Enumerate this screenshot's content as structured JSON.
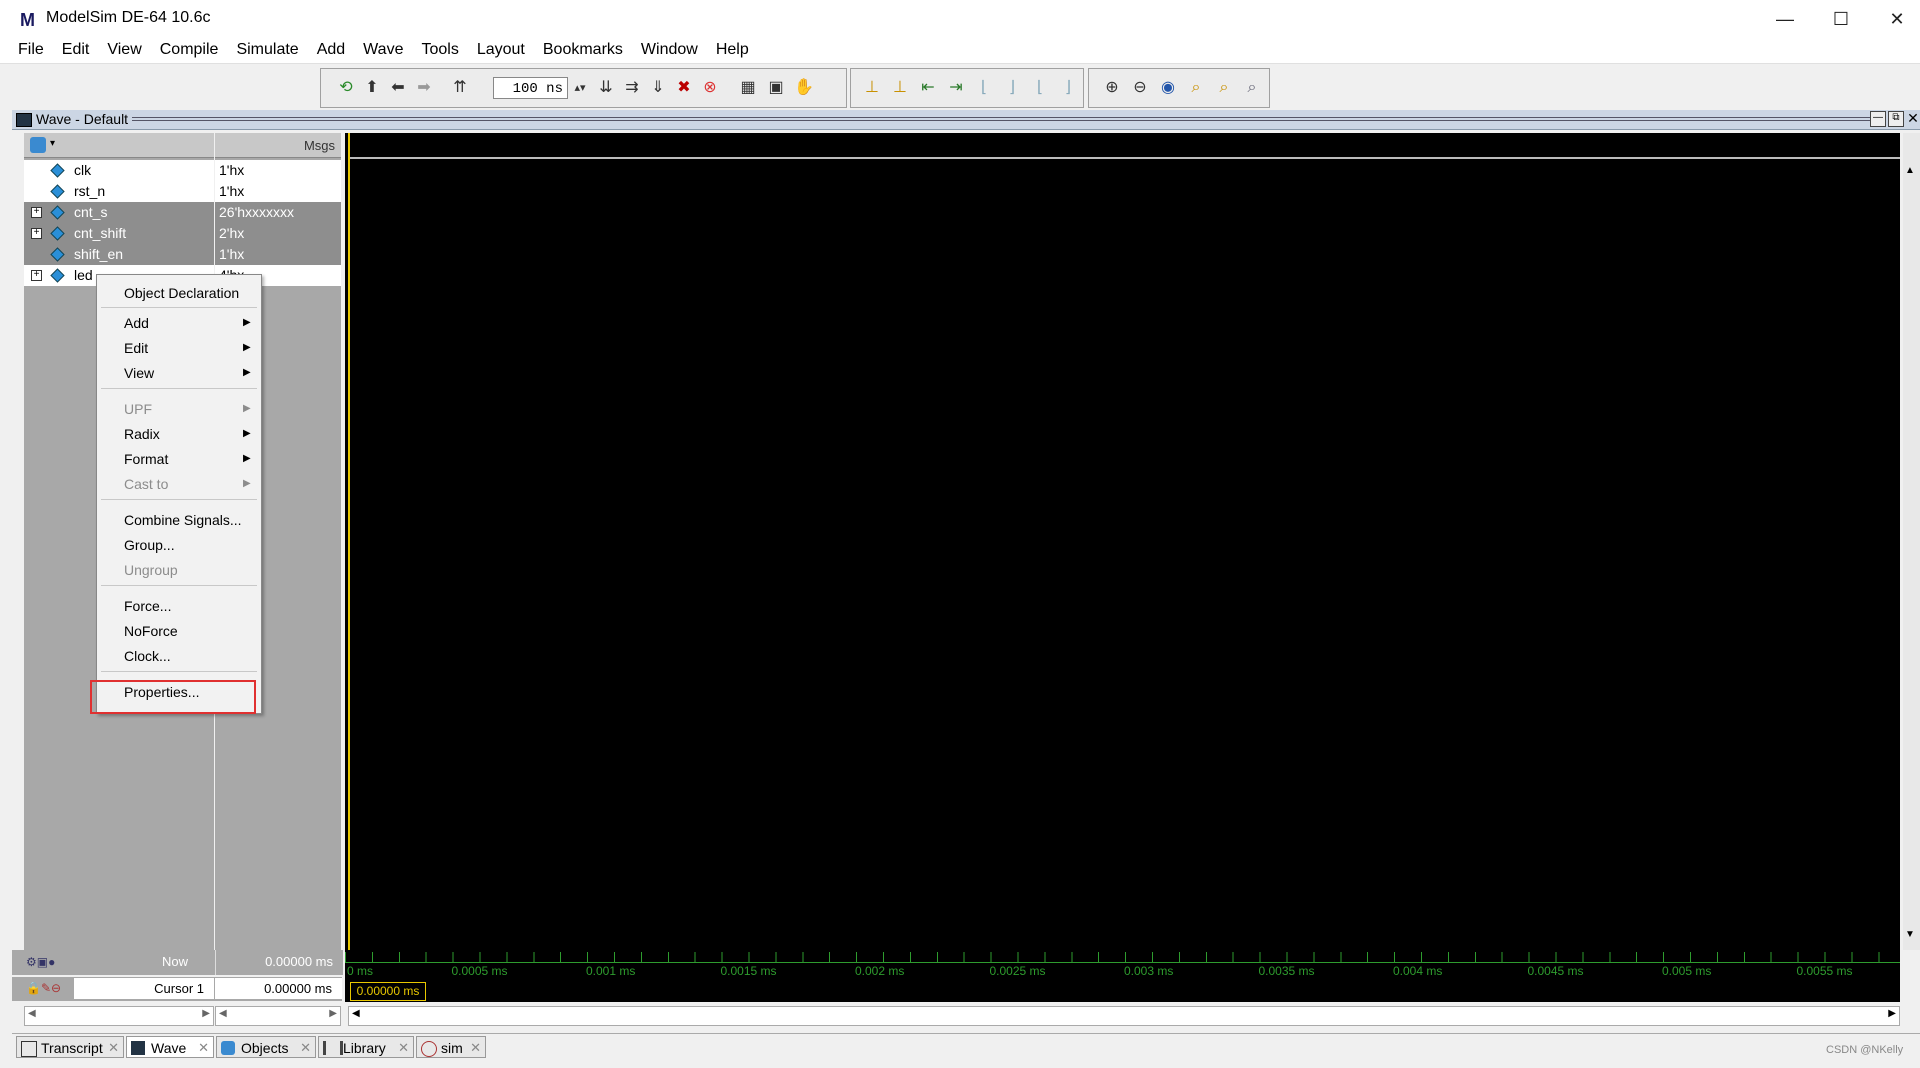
{
  "window": {
    "title": "ModelSim DE-64 10.6c",
    "logo": "M",
    "minimize": "—",
    "maximize": "☐",
    "close": "✕"
  },
  "menubar": [
    "File",
    "Edit",
    "View",
    "Compile",
    "Simulate",
    "Add",
    "Wave",
    "Tools",
    "Layout",
    "Bookmarks",
    "Window",
    "Help"
  ],
  "toolbar": {
    "time_value": "100 ns"
  },
  "wave": {
    "title": "Wave - Default",
    "msgs_header": "Msgs",
    "signals": [
      {
        "name": "clk",
        "value": "1'hx",
        "selected": true,
        "expandable": false
      },
      {
        "name": "rst_n",
        "value": "1'hx",
        "selected": true,
        "expandable": false
      },
      {
        "name": "cnt_s",
        "value": "26'hxxxxxxx",
        "selected": false,
        "expandable": true
      },
      {
        "name": "cnt_shift",
        "value": "2'hx",
        "selected": false,
        "expandable": true
      },
      {
        "name": "shift_en",
        "value": "1'hx",
        "selected": false,
        "expandable": false
      },
      {
        "name": "led",
        "value": "4'hx",
        "selected": true,
        "expandable": true
      }
    ],
    "now_label": "Now",
    "now_value": "0.00000 ms",
    "cursor_label": "Cursor 1",
    "cursor_value": "0.00000 ms",
    "cursor_box": "0.00000 ms",
    "ticks": [
      "0 ms",
      "0.0005 ms",
      "0.001 ms",
      "0.0015 ms",
      "0.002 ms",
      "0.0025 ms",
      "0.003 ms",
      "0.0035 ms",
      "0.004 ms",
      "0.0045 ms",
      "0.005 ms",
      "0.0055 ms"
    ]
  },
  "context_menu": {
    "object_declaration": "Object Declaration",
    "add": "Add",
    "edit": "Edit",
    "view": "View",
    "upf": "UPF",
    "radix": "Radix",
    "format": "Format",
    "cast_to": "Cast to",
    "combine_signals": "Combine Signals...",
    "group": "Group...",
    "ungroup": "Ungroup",
    "force": "Force...",
    "noforce": "NoForce",
    "clock": "Clock...",
    "properties": "Properties..."
  },
  "tabs": [
    "Transcript",
    "Wave",
    "Objects",
    "Library",
    "sim"
  ],
  "watermark": "CSDN @NKelly",
  "colors": {
    "cursor": "#e8c800",
    "highlight": "#e03030",
    "tick": "#2e9c2e"
  }
}
